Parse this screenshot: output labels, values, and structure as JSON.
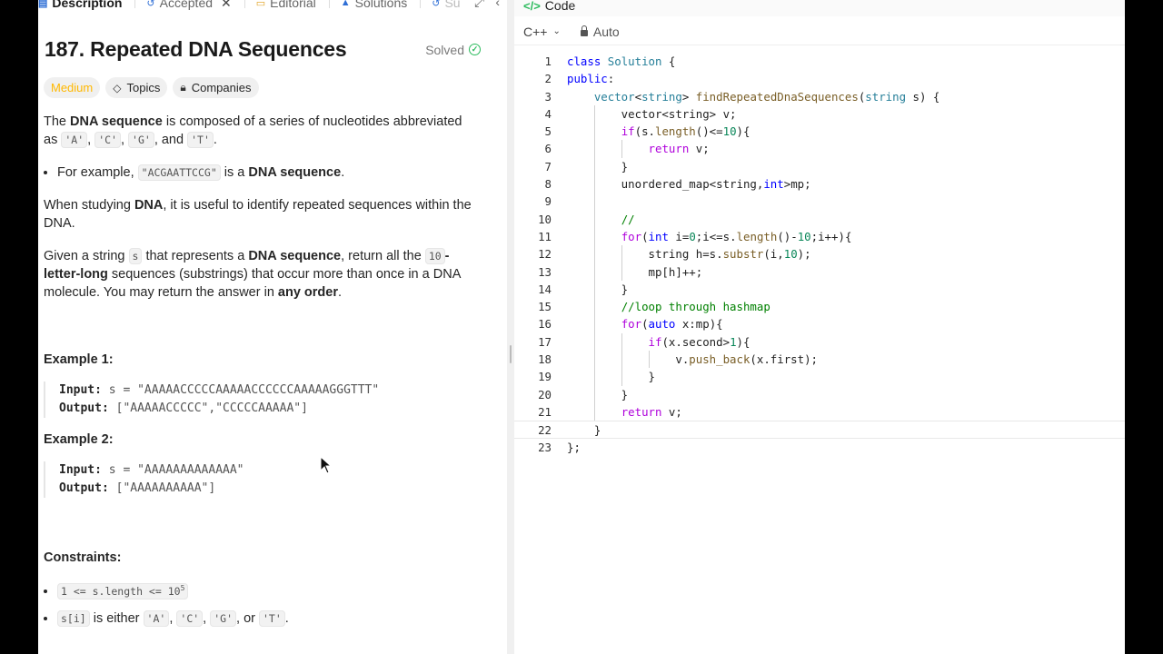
{
  "tabs": [
    {
      "label": "Description",
      "icon": "document-icon"
    },
    {
      "label": "Accepted",
      "icon": "history-icon"
    },
    {
      "label": "Editorial",
      "icon": "book-icon"
    },
    {
      "label": "Solutions",
      "icon": "flask-icon"
    },
    {
      "label": "Su",
      "icon": "history-icon"
    }
  ],
  "problem": {
    "title": "187. Repeated DNA Sequences",
    "status": "Solved",
    "difficulty": "Medium",
    "topics_label": "Topics",
    "companies_label": "Companies"
  },
  "description": {
    "p1_a": "The ",
    "p1_bold": "DNA sequence",
    "p1_b": " is composed of a series of nucleotides abbreviated as ",
    "nucleotides": [
      "'A'",
      "'C'",
      "'G'",
      "'T'"
    ],
    "sep_comma": ", ",
    "sep_and": ", and ",
    "period": ".",
    "bullet_a": "For example, ",
    "bullet_code": "\"ACGAATTCCG\"",
    "bullet_b": " is a ",
    "bullet_bold": "DNA sequence",
    "p2_a": "When studying ",
    "p2_bold": "DNA",
    "p2_b": ", it is useful to identify repeated sequences within the DNA.",
    "p3_a": "Given a string ",
    "p3_code1": "s",
    "p3_b": " that represents a ",
    "p3_bold1": "DNA sequence",
    "p3_c": ", return all the ",
    "p3_code2": "10",
    "p3_bold2": "-letter-long",
    "p3_d": " sequences (substrings) that occur more than once in a DNA molecule. You may return the answer in ",
    "p3_bold3": "any order"
  },
  "examples": [
    {
      "title": "Example 1:",
      "input_label": "Input:",
      "input": "s = \"AAAAACCCCCAAAAACCCCCCAAAAAGGGTTT\"",
      "output_label": "Output:",
      "output": "[\"AAAAACCCCC\",\"CCCCCAAAAA\"]"
    },
    {
      "title": "Example 2:",
      "input_label": "Input:",
      "input": "s = \"AAAAAAAAAAAAA\"",
      "output_label": "Output:",
      "output": "[\"AAAAAAAAAA\"]"
    }
  ],
  "constraints": {
    "title": "Constraints:",
    "c1_code": "1 <= s.length <= 10",
    "c1_sup": "5",
    "c2_code": "s[i]",
    "c2_text": " is either ",
    "c2_vals": [
      "'A'",
      "'C'",
      "'G'",
      "'T'"
    ],
    "c2_or": ", or "
  },
  "editor": {
    "header_title": "Code",
    "language": "C++",
    "mode": "Auto",
    "current_line": 22
  }
}
